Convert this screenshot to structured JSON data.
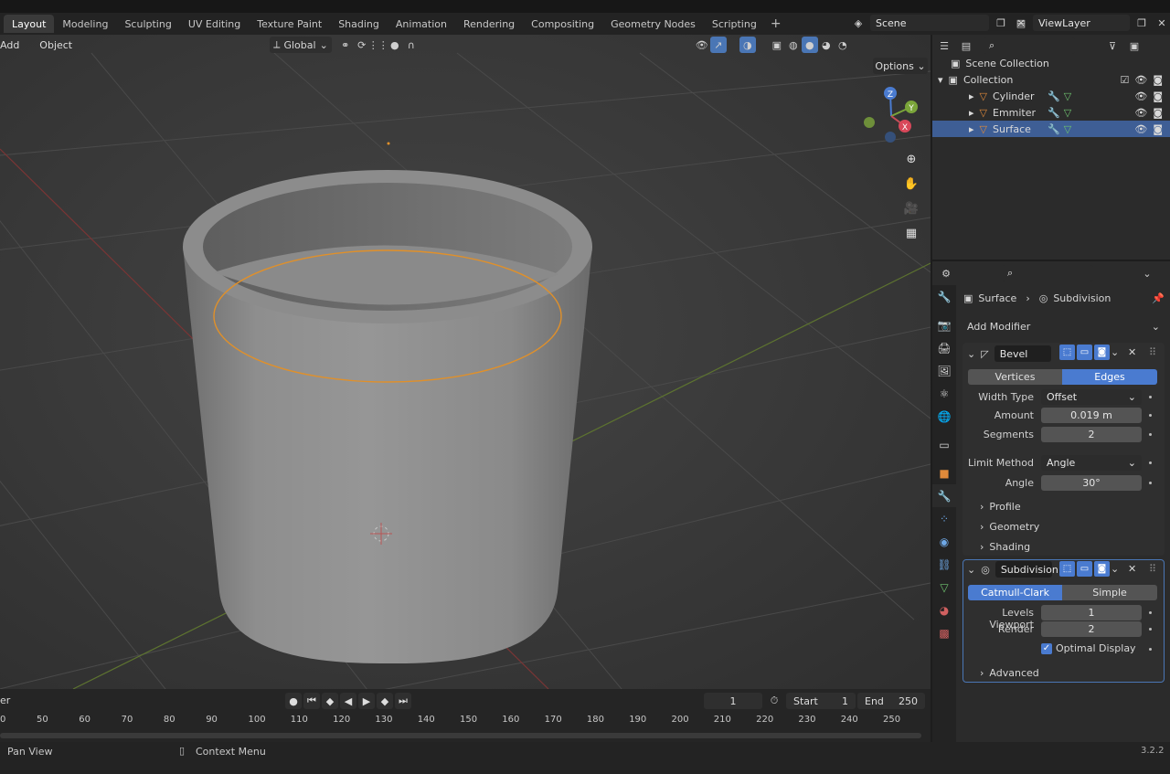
{
  "workspaces": [
    "Layout",
    "Modeling",
    "Sculpting",
    "UV Editing",
    "Texture Paint",
    "Shading",
    "Animation",
    "Rendering",
    "Compositing",
    "Geometry Nodes",
    "Scripting"
  ],
  "workspace_add": "+",
  "scene": {
    "label": "Scene",
    "view_layer": "ViewLayer"
  },
  "viewport_header": {
    "menu_add": "Add",
    "menu_object": "Object",
    "orientation": "Global",
    "options": "Options"
  },
  "nav_icons": [
    "zoom-icon",
    "hand-icon",
    "camera-icon",
    "grid-icon"
  ],
  "gizmo": {
    "z": "Z",
    "y": "Y",
    "x": "X"
  },
  "outliner": {
    "scene_collection": "Scene Collection",
    "collection": "Collection",
    "objects": [
      {
        "name": "Cylinder",
        "selected": false
      },
      {
        "name": "Emmiter",
        "selected": false
      },
      {
        "name": "Surface",
        "selected": true
      }
    ]
  },
  "properties": {
    "breadcrumb_object": "Surface",
    "breadcrumb_modifier": "Subdivision",
    "add_modifier": "Add Modifier",
    "bevel": {
      "name": "Bevel",
      "mode_vertices": "Vertices",
      "mode_edges": "Edges",
      "width_type_label": "Width Type",
      "width_type": "Offset",
      "amount_label": "Amount",
      "amount": "0.019 m",
      "segments_label": "Segments",
      "segments": "2",
      "limit_method_label": "Limit Method",
      "limit_method": "Angle",
      "angle_label": "Angle",
      "angle": "30°",
      "profile": "Profile",
      "geometry": "Geometry",
      "shading": "Shading"
    },
    "subdivision": {
      "name": "Subdivision",
      "mode_catmull": "Catmull-Clark",
      "mode_simple": "Simple",
      "levels_viewport_label": "Levels Viewport",
      "levels_viewport": "1",
      "render_label": "Render",
      "render": "2",
      "optimal_display": "Optimal Display",
      "advanced": "Advanced"
    }
  },
  "timeline": {
    "current_frame": "1",
    "start_label": "Start",
    "start": "1",
    "end_label": "End",
    "end": "250",
    "left_label": "er",
    "ticks": [
      "0",
      "50",
      "60",
      "70",
      "80",
      "90",
      "100",
      "110",
      "120",
      "130",
      "140",
      "150",
      "160",
      "170",
      "180",
      "190",
      "200",
      "210",
      "220",
      "230",
      "240",
      "250"
    ]
  },
  "status": {
    "pan_view": "Pan View",
    "context_menu": "Context Menu",
    "version": "3.2.2"
  },
  "colors": {
    "accent": "#4a7bd0",
    "selection": "#3e5e95",
    "outline_orange": "#e0902a"
  }
}
